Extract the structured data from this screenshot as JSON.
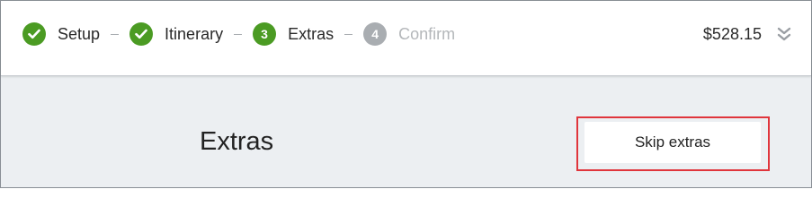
{
  "steps": [
    {
      "number": "1",
      "label": "Setup",
      "status": "done"
    },
    {
      "number": "2",
      "label": "Itinerary",
      "status": "done"
    },
    {
      "number": "3",
      "label": "Extras",
      "status": "current"
    },
    {
      "number": "4",
      "label": "Confirm",
      "status": "todo"
    }
  ],
  "header": {
    "total": "$528.15",
    "expand_icon": "double-chevron-down-icon"
  },
  "main": {
    "title": "Extras",
    "skip_label": "Skip extras"
  },
  "colors": {
    "accent_green": "#4b9b23",
    "inactive_gray": "#a9adb1",
    "highlight_red": "#e0353c",
    "page_bg": "#eceff2"
  }
}
